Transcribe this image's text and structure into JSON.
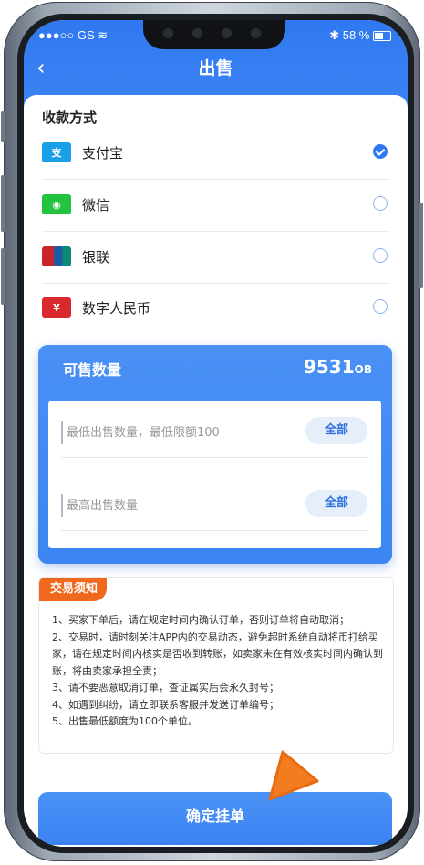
{
  "status_bar": {
    "carrier": "GS",
    "battery": "58 %"
  },
  "nav": {
    "title": "出售"
  },
  "payment": {
    "section_title": "收款方式",
    "methods": [
      {
        "label": "支付宝",
        "icon": "alipay-icon",
        "selected": true,
        "color": "#1aa0e6"
      },
      {
        "label": "微信",
        "icon": "wechat-icon",
        "selected": false,
        "color": "#22c33f"
      },
      {
        "label": "银联",
        "icon": "unionpay-icon",
        "selected": false,
        "color": "#c9252a"
      },
      {
        "label": "数字人民币",
        "icon": "digital-rmb-icon",
        "selected": false,
        "color": "#d9282e"
      }
    ]
  },
  "quantity": {
    "title": "可售数量",
    "value": "9531",
    "unit": "OB",
    "min_placeholder": "最低出售数量，最低限额100",
    "max_placeholder": "最高出售数量",
    "all_label": "全部"
  },
  "notice": {
    "tag": "交易须知",
    "lines": [
      "1、买家下单后，请在规定时间内确认订单，否则订单将自动取消；",
      "2、交易时，请时刻关注APP内的交易动态，避免超时系统自动将币打给买家，请在规定时间内核实是否收到转账，如卖家未在有效核实时间内确认到账，将由卖家承担全责；",
      "3、请不要恶意取消订单，查证属实后会永久封号；",
      "4、如遇到纠纷，请立即联系客服并发送订单编号；",
      "5、出售最低额度为100个单位。"
    ]
  },
  "submit_label": "确定挂单",
  "colors": {
    "primary": "#3a83f2",
    "accent": "#f0681e"
  }
}
